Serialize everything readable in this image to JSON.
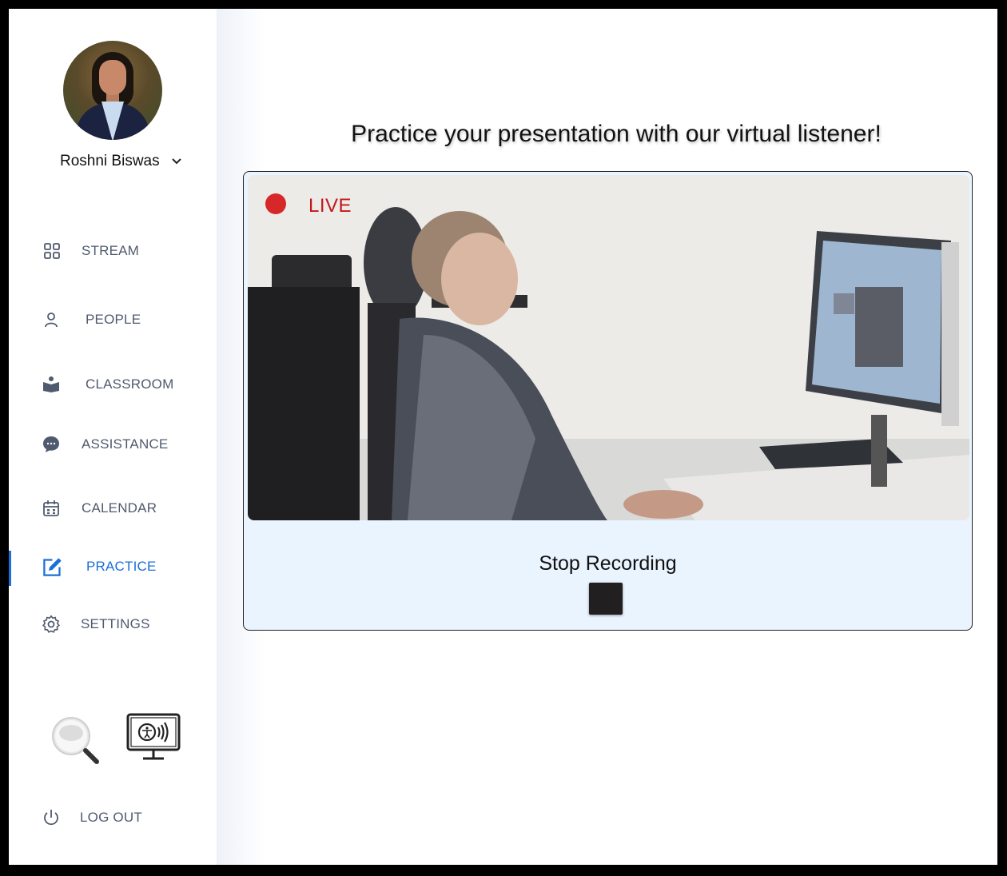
{
  "user": {
    "name": "Roshni Biswas"
  },
  "nav": [
    {
      "label": "STREAM",
      "icon": "grid-icon"
    },
    {
      "label": "PEOPLE",
      "icon": "person-icon"
    },
    {
      "label": "CLASSROOM",
      "icon": "book-reader-icon"
    },
    {
      "label": "ASSISTANCE",
      "icon": "chat-bubble-icon"
    },
    {
      "label": "CALENDAR",
      "icon": "calendar-icon"
    },
    {
      "label": "PRACTICE",
      "icon": "edit-icon",
      "active": true
    },
    {
      "label": "SETTINGS",
      "icon": "gear-icon"
    }
  ],
  "logout": {
    "label": "LOG OUT"
  },
  "main": {
    "heading": "Practice your presentation with our virtual listener!",
    "live_label": "LIVE",
    "stop_label": "Stop Recording"
  },
  "colors": {
    "accent": "#1a6fd8",
    "live": "#d62828",
    "card_bg": "#e9f4fe"
  }
}
